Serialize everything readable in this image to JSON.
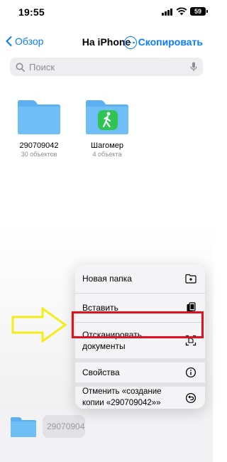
{
  "status_bar": {
    "time": "19:55",
    "battery": "59"
  },
  "nav": {
    "back_label": "Обзор",
    "title": "На iPhone",
    "copy_label": "Скопировать"
  },
  "search": {
    "placeholder": "Поиск"
  },
  "folders": [
    {
      "name": "290709042",
      "subtitle": "30 объектов"
    },
    {
      "name": "Шагомер",
      "subtitle": "4 объекта"
    }
  ],
  "context_menu": {
    "items": [
      {
        "label": "Новая папка",
        "icon": "new-folder-icon"
      },
      {
        "label": "Вставить",
        "icon": "paste-icon"
      },
      {
        "label": "Отсканировать документы",
        "icon": "scan-icon"
      },
      {
        "label": "Свойства",
        "icon": "info-icon"
      },
      {
        "label": "Отменить «создание копии «290709042»»",
        "icon": "undo-icon"
      }
    ]
  },
  "bottom_bar": {
    "filename_preview": "290709042"
  },
  "colors": {
    "accent": "#0a7cff",
    "folder": "#5ab0f0",
    "highlight": "#e3101f",
    "arrow": "#f3ee1a",
    "app_icon": "#2fc454"
  }
}
